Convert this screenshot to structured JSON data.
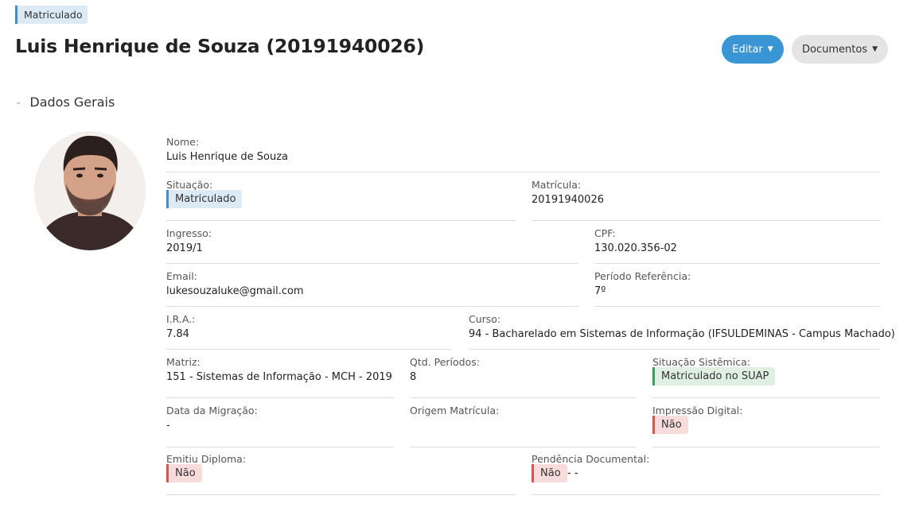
{
  "header": {
    "status_tag": "Matriculado",
    "title": "Luis Henrique de Souza (20191940026)",
    "edit_label": "Editar",
    "docs_label": "Documentos"
  },
  "section": {
    "title": "Dados Gerais"
  },
  "fields": {
    "nome": {
      "label": "Nome:",
      "value": "Luis Henrique de Souza"
    },
    "situacao": {
      "label": "Situação:",
      "value": "Matriculado"
    },
    "matricula": {
      "label": "Matrícula:",
      "value": "20191940026"
    },
    "ingresso": {
      "label": "Ingresso:",
      "value": "2019/1"
    },
    "cpf": {
      "label": "CPF:",
      "value": "130.020.356-02"
    },
    "email": {
      "label": "Email:",
      "value": "lukesouzaluke@gmail.com"
    },
    "periodo_referencia": {
      "label": "Período Referência:",
      "value": "7º"
    },
    "ira": {
      "label": "I.R.A.:",
      "value": "7.84"
    },
    "curso": {
      "label": "Curso:",
      "value": "94 - Bacharelado em Sistemas de Informação (IFSULDEMINAS - Campus Machado)"
    },
    "matriz": {
      "label": "Matriz:",
      "value": "151 - Sistemas de Informação - MCH - 2019"
    },
    "qtd_periodos": {
      "label": "Qtd. Períodos:",
      "value": "8"
    },
    "situacao_sistemica": {
      "label": "Situação Sistêmica:",
      "value": "Matriculado no SUAP"
    },
    "data_migracao": {
      "label": "Data da Migração:",
      "value": "-"
    },
    "origem_matricula": {
      "label": "Origem Matrícula:",
      "value": ""
    },
    "impressao_digital": {
      "label": "Impressão Digital:",
      "value": "Não"
    },
    "emitiu_diploma": {
      "label": "Emitiu Diploma:",
      "value": "Não"
    },
    "pendencia_documental": {
      "label": "Pendência Documental:",
      "value": "Não",
      "extra": "- -"
    }
  },
  "colors": {
    "primary": "#3a95d5",
    "info_bg": "#dbeaf5",
    "success_bg": "#dff0e3",
    "danger_bg": "#f8dcdc"
  }
}
